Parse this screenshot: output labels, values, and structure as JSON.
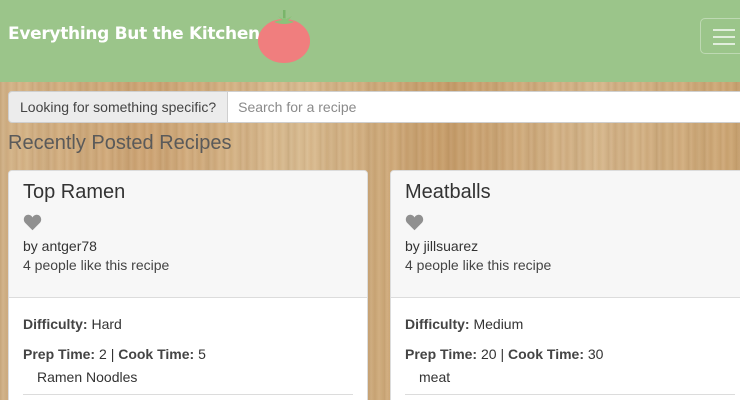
{
  "navbar": {
    "brand": "Everything But the Kitchen Sink",
    "logo_icon": "tomato-icon",
    "menu_icon": "hamburger-menu-icon",
    "color": "#9bc58a"
  },
  "search": {
    "label": "Looking for something specific?",
    "placeholder": "Search for a recipe",
    "value": ""
  },
  "section_title": "Recently Posted Recipes",
  "labels": {
    "difficulty": "Difficulty:",
    "prep_time": "Prep Time:",
    "cook_time": "Cook Time:",
    "separator": "|"
  },
  "recipes": [
    {
      "title": "Top Ramen",
      "author": "by antger78",
      "likes": "4 people like this recipe",
      "difficulty": "Hard",
      "prep_time": "2",
      "cook_time": "5",
      "ingredient": "Ramen Noodles",
      "heart_icon": "heart-icon"
    },
    {
      "title": "Meatballs",
      "author": "by jillsuarez",
      "likes": "4 people like this recipe",
      "difficulty": "Medium",
      "prep_time": "20",
      "cook_time": "30",
      "ingredient": "meat",
      "heart_icon": "heart-icon"
    }
  ]
}
